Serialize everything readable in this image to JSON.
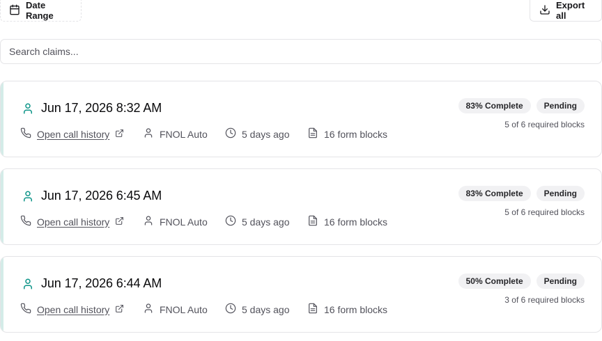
{
  "toolbar": {
    "date_range_label": "Date Range",
    "export_label": "Export all"
  },
  "search": {
    "placeholder": "Search claims..."
  },
  "colors": {
    "accent": "#0d9488",
    "card_stripe": "#d4ece8",
    "badge_bg": "#f1f1f3"
  },
  "claims": [
    {
      "title": "Jun 17, 2026 8:32 AM",
      "call_link": "Open call history",
      "type": "FNOL Auto",
      "age": "5 days ago",
      "blocks": "16 form blocks",
      "completion": "83% Complete",
      "status": "Pending",
      "required": "5 of 6 required blocks"
    },
    {
      "title": "Jun 17, 2026 6:45 AM",
      "call_link": "Open call history",
      "type": "FNOL Auto",
      "age": "5 days ago",
      "blocks": "16 form blocks",
      "completion": "83% Complete",
      "status": "Pending",
      "required": "5 of 6 required blocks"
    },
    {
      "title": "Jun 17, 2026 6:44 AM",
      "call_link": "Open call history",
      "type": "FNOL Auto",
      "age": "5 days ago",
      "blocks": "16 form blocks",
      "completion": "50% Complete",
      "status": "Pending",
      "required": "3 of 6 required blocks"
    }
  ]
}
